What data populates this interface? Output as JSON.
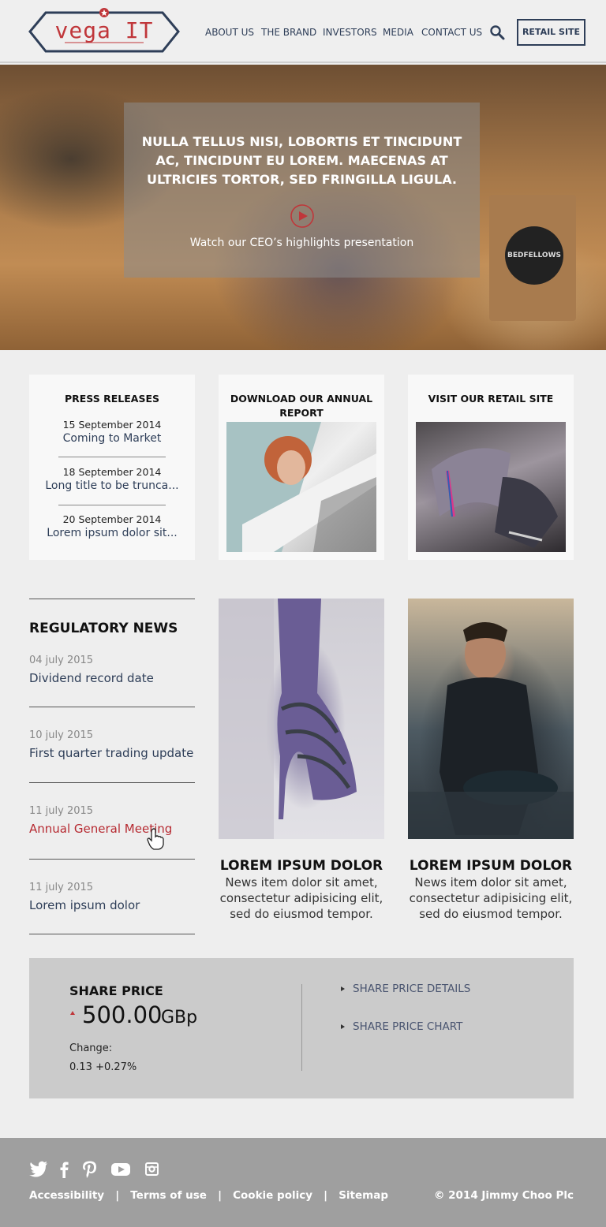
{
  "header": {
    "logo_text": "vega IT",
    "nav": [
      "ABOUT US",
      "THE BRAND",
      "INVESTORS",
      "MEDIA",
      "CONTACT US"
    ],
    "retail_button": "RETAIL SITE"
  },
  "hero": {
    "headline": "NULLA TELLUS NISI, LOBORTIS ET TINCIDUNT AC, TINCIDUNT EU LOREM. MAECENAS AT ULTRICIES TORTOR, SED FRINGILLA LIGULA.",
    "caption": "Watch our CEO’s highlights presentation",
    "bag_label": "BEDFELLOWS"
  },
  "press_releases": {
    "title": "PRESS RELEASES",
    "items": [
      {
        "date": "15 September 2014",
        "title": "Coming to Market"
      },
      {
        "date": "18 September 2014",
        "title": "Long title to be trunca..."
      },
      {
        "date": "20 September 2014",
        "title": "Lorem ipsum dolor sit..."
      }
    ]
  },
  "annual_report": {
    "title": "DOWNLOAD OUR ANNUAL REPORT"
  },
  "retail_card": {
    "title": "VISIT OUR RETAIL SITE"
  },
  "regulatory_news": {
    "title": "REGULATORY NEWS",
    "items": [
      {
        "date": "04 july 2015",
        "title": "Dividend record date"
      },
      {
        "date": "10 july 2015",
        "title": "First quarter trading update"
      },
      {
        "date": "11 july 2015",
        "title": "Annual General Meeting"
      },
      {
        "date": "11 july 2015",
        "title": "Lorem ipsum dolor"
      }
    ]
  },
  "news": [
    {
      "title": "LOREM IPSUM DOLOR",
      "body": "News item dolor sit amet, consectetur adipisicing elit, sed do eiusmod tempor."
    },
    {
      "title": "LOREM IPSUM DOLOR",
      "body": "News item dolor sit amet, consectetur adipisicing elit, sed do eiusmod tempor."
    }
  ],
  "share_price": {
    "label": "SHARE PRICE",
    "value": "500.00",
    "unit": "GBp",
    "change_label": "Change:",
    "change_value": "0.13  +0.27%",
    "links": [
      "SHARE PRICE DETAILS",
      "SHARE PRICE CHART"
    ]
  },
  "footer": {
    "links": [
      "Accessibility",
      "Terms of use",
      "Cookie policy",
      "Sitemap"
    ],
    "separator": "|",
    "copyright": "© 2014 Jimmy Choo Plc"
  },
  "colors": {
    "navy": "#2e3e58",
    "red": "#c0363a",
    "footer_bg": "#9f9f9f"
  }
}
